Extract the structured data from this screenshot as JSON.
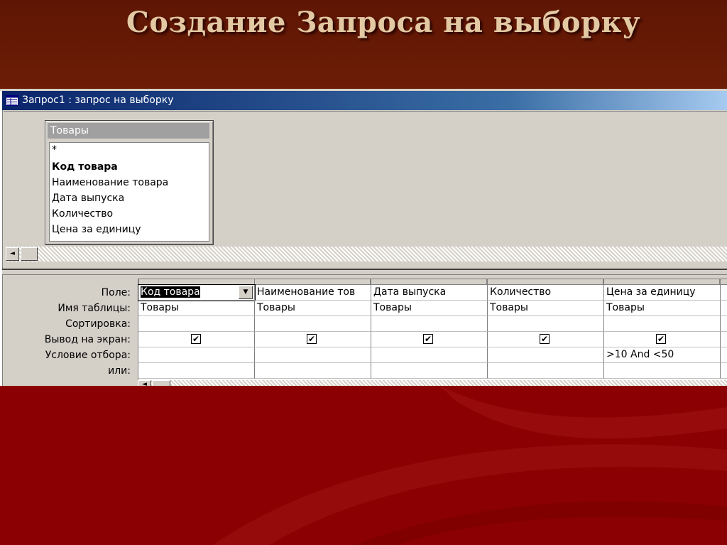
{
  "slide": {
    "title": "Создание Запроса на выборку"
  },
  "window": {
    "title": "Запрос1 : запрос на выборку",
    "icon": "query-icon"
  },
  "table_box": {
    "name": "Товары",
    "fields": [
      "*",
      "Код товара",
      "Наименование товара",
      "Дата выпуска",
      "Количество",
      "Цена за единицу"
    ]
  },
  "grid": {
    "row_labels": [
      "Поле:",
      "Имя таблицы:",
      "Сортировка:",
      "Вывод на экран:",
      "Условие отбора:",
      "или:"
    ],
    "columns": [
      {
        "field": "Код товара",
        "table": "Товары",
        "sort": "",
        "show": true,
        "criteria": "",
        "or": ""
      },
      {
        "field": "Наименование тов",
        "table": "Товары",
        "sort": "",
        "show": true,
        "criteria": "",
        "or": ""
      },
      {
        "field": "Дата выпуска",
        "table": "Товары",
        "sort": "",
        "show": true,
        "criteria": "",
        "or": ""
      },
      {
        "field": "Количество",
        "table": "Товары",
        "sort": "",
        "show": true,
        "criteria": "",
        "or": ""
      },
      {
        "field": "Цена за единицу",
        "table": "Товары",
        "sort": "",
        "show": true,
        "criteria": ">10 And <50",
        "or": ""
      }
    ],
    "check_mark": "✔",
    "dropdown_glyph": "▼",
    "scroll_left_glyph": "◄"
  },
  "colors": {
    "slide_bg": "#6b1a05",
    "slide_bottom": "#8b0002",
    "title_text": "#e3c9a3",
    "window_bg": "#d4d0c8",
    "titlebar": "#0a246a"
  }
}
